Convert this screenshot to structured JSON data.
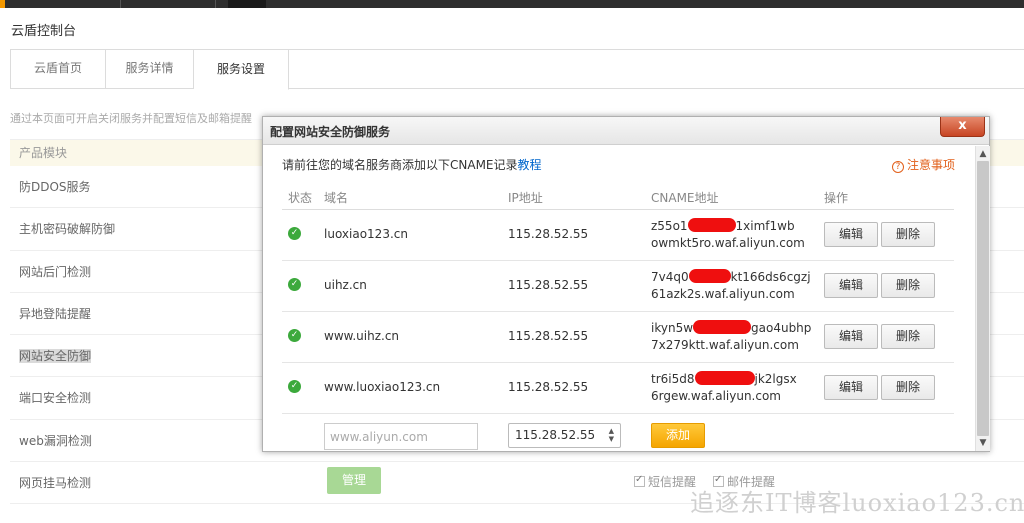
{
  "console_title": "云盾控制台",
  "tabs": [
    {
      "label": "云盾首页"
    },
    {
      "label": "服务详情"
    },
    {
      "label": "服务设置"
    }
  ],
  "description": "通过本页面可开启关闭服务并配置短信及邮箱提醒",
  "module_header": "产品模块",
  "modules": [
    "防DDOS服务",
    "主机密码破解防御",
    "网站后门检测",
    "异地登陆提醒",
    "网站安全防御",
    "端口安全检测",
    "web漏洞检测",
    "网页挂马检测"
  ],
  "manage_button": "管理",
  "sms_alert": "短信提醒",
  "email_alert": "邮件提醒",
  "watermark": "追逐东IT博客luoxiao123.cn",
  "dialog": {
    "title": "配置网站安全防御服务",
    "close_label": "x",
    "notice_text": "请前往您的域名服务商添加以下CNAME记录",
    "notice_link": "教程",
    "help_label": "注意事项",
    "columns": {
      "status": "状态",
      "domain": "域名",
      "ip": "IP地址",
      "cname": "CNAME地址",
      "action": "操作"
    },
    "rows": [
      {
        "domain": "luoxiao123.cn",
        "ip": "115.28.52.55",
        "cname_a": "z55o1",
        "cname_b": "1ximf1wb",
        "cname_c": "owmkt5ro.waf.aliyun.com"
      },
      {
        "domain": "uihz.cn",
        "ip": "115.28.52.55",
        "cname_a": "7v4q0",
        "cname_b": "kt166ds6cgzj",
        "cname_c": "61azk2s.waf.aliyun.com"
      },
      {
        "domain": "www.uihz.cn",
        "ip": "115.28.52.55",
        "cname_a": "ikyn5w",
        "cname_b": "gao4ubhp",
        "cname_c": "7x279ktt.waf.aliyun.com"
      },
      {
        "domain": "www.luoxiao123.cn",
        "ip": "115.28.52.55",
        "cname_a": "tr6i5d8",
        "cname_b": "jk2lgsx",
        "cname_c": "6rgew.waf.aliyun.com"
      }
    ],
    "edit_label": "编辑",
    "delete_label": "删除",
    "domain_placeholder": "www.aliyun.com",
    "ip_selected": "115.28.52.55",
    "add_label": "添加",
    "status_color": "#3ca93c",
    "accent_color": "#f5a500"
  }
}
